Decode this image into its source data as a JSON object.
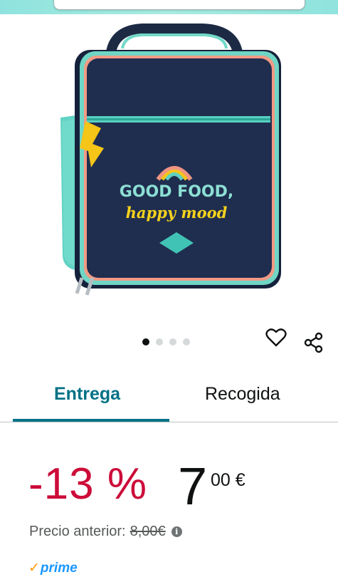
{
  "search": {
    "placeholder": ""
  },
  "product": {
    "image_icon": "lunch-bag-image",
    "image_text": {
      "line1": "GOOD FOOD,",
      "line2": "happy mood"
    },
    "carousel": {
      "total": 4,
      "active": 1
    }
  },
  "actions": {
    "wishlist_icon": "heart-icon",
    "share_icon": "share-icon"
  },
  "tabs": [
    {
      "label": "Entrega",
      "active": true
    },
    {
      "label": "Recogida",
      "active": false
    }
  ],
  "price": {
    "discount": "-13 %",
    "whole": "7",
    "fraction": "00 €",
    "previous_label": "Precio anterior:",
    "previous_value": "8,00€",
    "info_icon": "i"
  },
  "prime": {
    "check": "✓",
    "label": "prime"
  },
  "colors": {
    "accent": "#007185",
    "discount": "#cc0c39",
    "prime": "#1a98ff",
    "prime_check": "#ff9900"
  }
}
